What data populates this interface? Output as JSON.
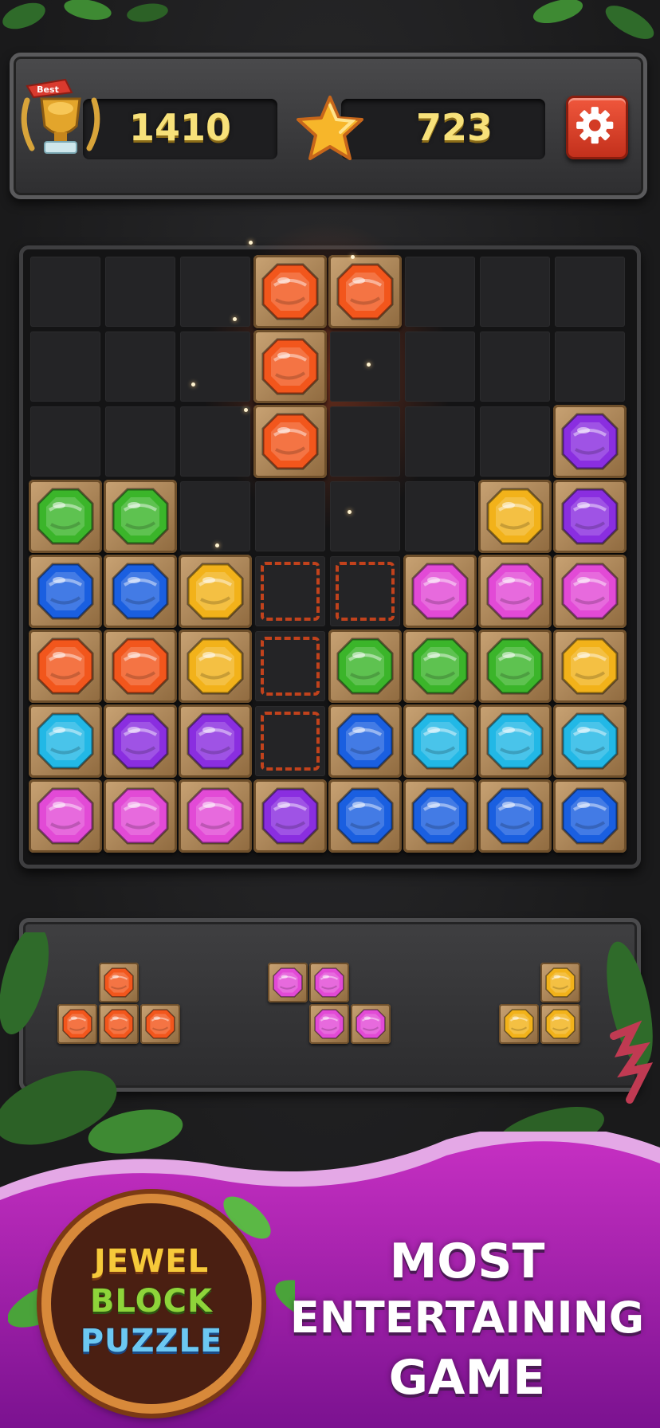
{
  "header": {
    "best_score": "1410",
    "current_score": "723",
    "trophy_ribbon": "Best",
    "trophy_icon": "trophy-icon",
    "star_icon": "star-icon",
    "settings_icon": "gear-icon"
  },
  "colors": {
    "orange": "#f2561c",
    "red_orange": "#ea4e18",
    "green": "#3bb52a",
    "blue": "#1a5fe0",
    "yellow": "#f2b21a",
    "pink": "#e24ad6",
    "purple": "#8a2ee0",
    "cyan": "#22b8e6",
    "ghost_outline": "#c2421c",
    "settings_red": "#e04630",
    "score_gold": "#f7e17a",
    "footer_purple": "#b21fb6"
  },
  "board": {
    "rows": 8,
    "cols": 8,
    "grid": [
      [
        "",
        "",
        "",
        "orange",
        "orange",
        "",
        "",
        ""
      ],
      [
        "",
        "",
        "",
        "orange",
        "",
        "",
        "",
        ""
      ],
      [
        "",
        "",
        "",
        "orange",
        "",
        "",
        "",
        "purple"
      ],
      [
        "green",
        "green",
        "",
        "",
        "",
        "",
        "yellow",
        "purple"
      ],
      [
        "blue",
        "blue",
        "yellow",
        "ghost",
        "ghost",
        "pink",
        "pink",
        "pink"
      ],
      [
        "orange",
        "orange",
        "yellow",
        "ghost",
        "green",
        "green",
        "green",
        "yellow"
      ],
      [
        "cyan",
        "purple",
        "purple",
        "ghost",
        "blue",
        "cyan",
        "cyan",
        "cyan"
      ],
      [
        "pink",
        "pink",
        "pink",
        "purple",
        "blue",
        "blue",
        "blue",
        "blue"
      ]
    ],
    "dragging_piece": "orange"
  },
  "tray": {
    "pieces": [
      {
        "name": "tray-piece-orange-t",
        "color": "orange",
        "cells": [
          [
            1,
            0
          ],
          [
            0,
            1
          ],
          [
            1,
            1
          ],
          [
            2,
            1
          ]
        ]
      },
      {
        "name": "tray-piece-pink-z",
        "color": "pink",
        "cells": [
          [
            0,
            0
          ],
          [
            1,
            0
          ],
          [
            1,
            1
          ],
          [
            2,
            1
          ]
        ]
      },
      {
        "name": "tray-piece-yellow-l",
        "color": "yellow",
        "cells": [
          [
            1,
            0
          ],
          [
            0,
            1
          ],
          [
            1,
            1
          ]
        ]
      }
    ]
  },
  "promo": {
    "logo_line1": "JEWEL",
    "logo_line2": "BLOCK",
    "logo_line3": "PUZZLE",
    "tagline_line1": "MOST",
    "tagline_line2": "ENTERTAINING",
    "tagline_line3": "GAME"
  }
}
